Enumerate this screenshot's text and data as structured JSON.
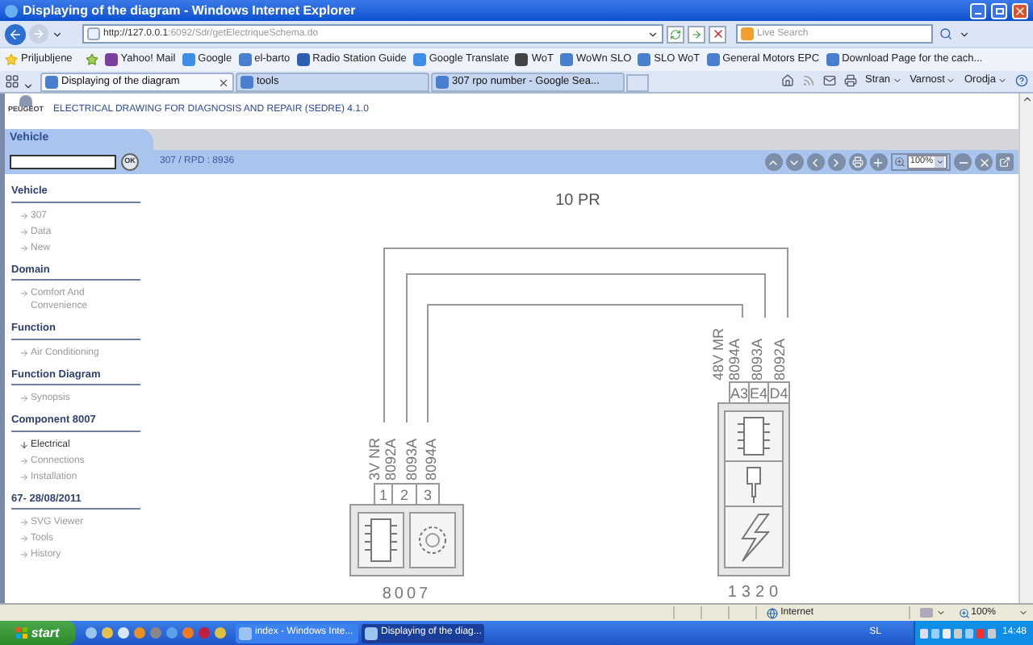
{
  "window": {
    "title": "Displaying of the diagram - Windows Internet Explorer"
  },
  "address_bar": {
    "url_host": "http://127.0.0.1",
    "url_rest": ":6092/Sdr/getElectriqueSchema.do"
  },
  "search": {
    "placeholder": "Live Search"
  },
  "favorites": {
    "label": "Priljubljene",
    "items": [
      "Yahoo! Mail",
      "Google",
      "el-barto",
      "Radio Station Guide",
      "Google Translate",
      "WoT",
      "WoWn SLO",
      "SLO WoT",
      "General Motors EPC",
      "Download Page for the cach..."
    ]
  },
  "tabs": [
    {
      "label": "Displaying of the diagram",
      "selected": true
    },
    {
      "label": "tools",
      "selected": false
    },
    {
      "label": "307 rpo number - Google Sea...",
      "selected": false
    }
  ],
  "command_bar": [
    "Stran",
    "Varnost",
    "Orodja"
  ],
  "app": {
    "brand": "PEUGEOT",
    "title": "ELECTRICAL DRAWING FOR DIAGNOSIS AND REPAIR (SEDRE) 4.1.0",
    "section_tab": "Vehicle",
    "ok_button": "OK",
    "breadcrumb": "307 / RPD : 8936",
    "zoom": "100%"
  },
  "sidebar": [
    {
      "title": "Vehicle",
      "items": [
        {
          "label": "307",
          "selected": false
        },
        {
          "label": "Data",
          "selected": false
        },
        {
          "label": "New",
          "selected": false
        }
      ]
    },
    {
      "title": "Domain",
      "items": [
        {
          "label": "Comfort And Convenience",
          "selected": false
        }
      ]
    },
    {
      "title": "Function",
      "items": [
        {
          "label": "Air Conditioning",
          "selected": false
        }
      ]
    },
    {
      "title": "Function Diagram",
      "items": [
        {
          "label": "Synopsis",
          "selected": false
        }
      ]
    },
    {
      "title": "Component 8007",
      "items": [
        {
          "label": "Electrical",
          "selected": true
        },
        {
          "label": "Connections",
          "selected": false
        },
        {
          "label": "Installation",
          "selected": false
        }
      ]
    },
    {
      "title": "67- 28/08/2011",
      "items": [
        {
          "label": "SVG Viewer",
          "selected": false
        },
        {
          "label": "Tools",
          "selected": false
        },
        {
          "label": "History",
          "selected": false
        }
      ]
    }
  ],
  "diagram": {
    "title": "10 PR",
    "left_component": {
      "id": "8007",
      "pins": [
        "1",
        "2",
        "3"
      ],
      "wire_labels": [
        "3V NR",
        "8092A",
        "8093A",
        "8094A"
      ]
    },
    "right_component": {
      "id": "1320",
      "pins": [
        "A3",
        "E4",
        "D4"
      ],
      "wire_labels": [
        "48V MR",
        "8094A",
        "8093A",
        "8092A"
      ]
    }
  },
  "status_bar": {
    "zone": "Internet",
    "zoom": "100%"
  },
  "taskbar": {
    "start": "start",
    "tasks": [
      {
        "label": "index - Windows Inte...",
        "selected": false
      },
      {
        "label": "Displaying of the diag...",
        "selected": true
      }
    ],
    "language": "SL",
    "clock": "14:48"
  }
}
